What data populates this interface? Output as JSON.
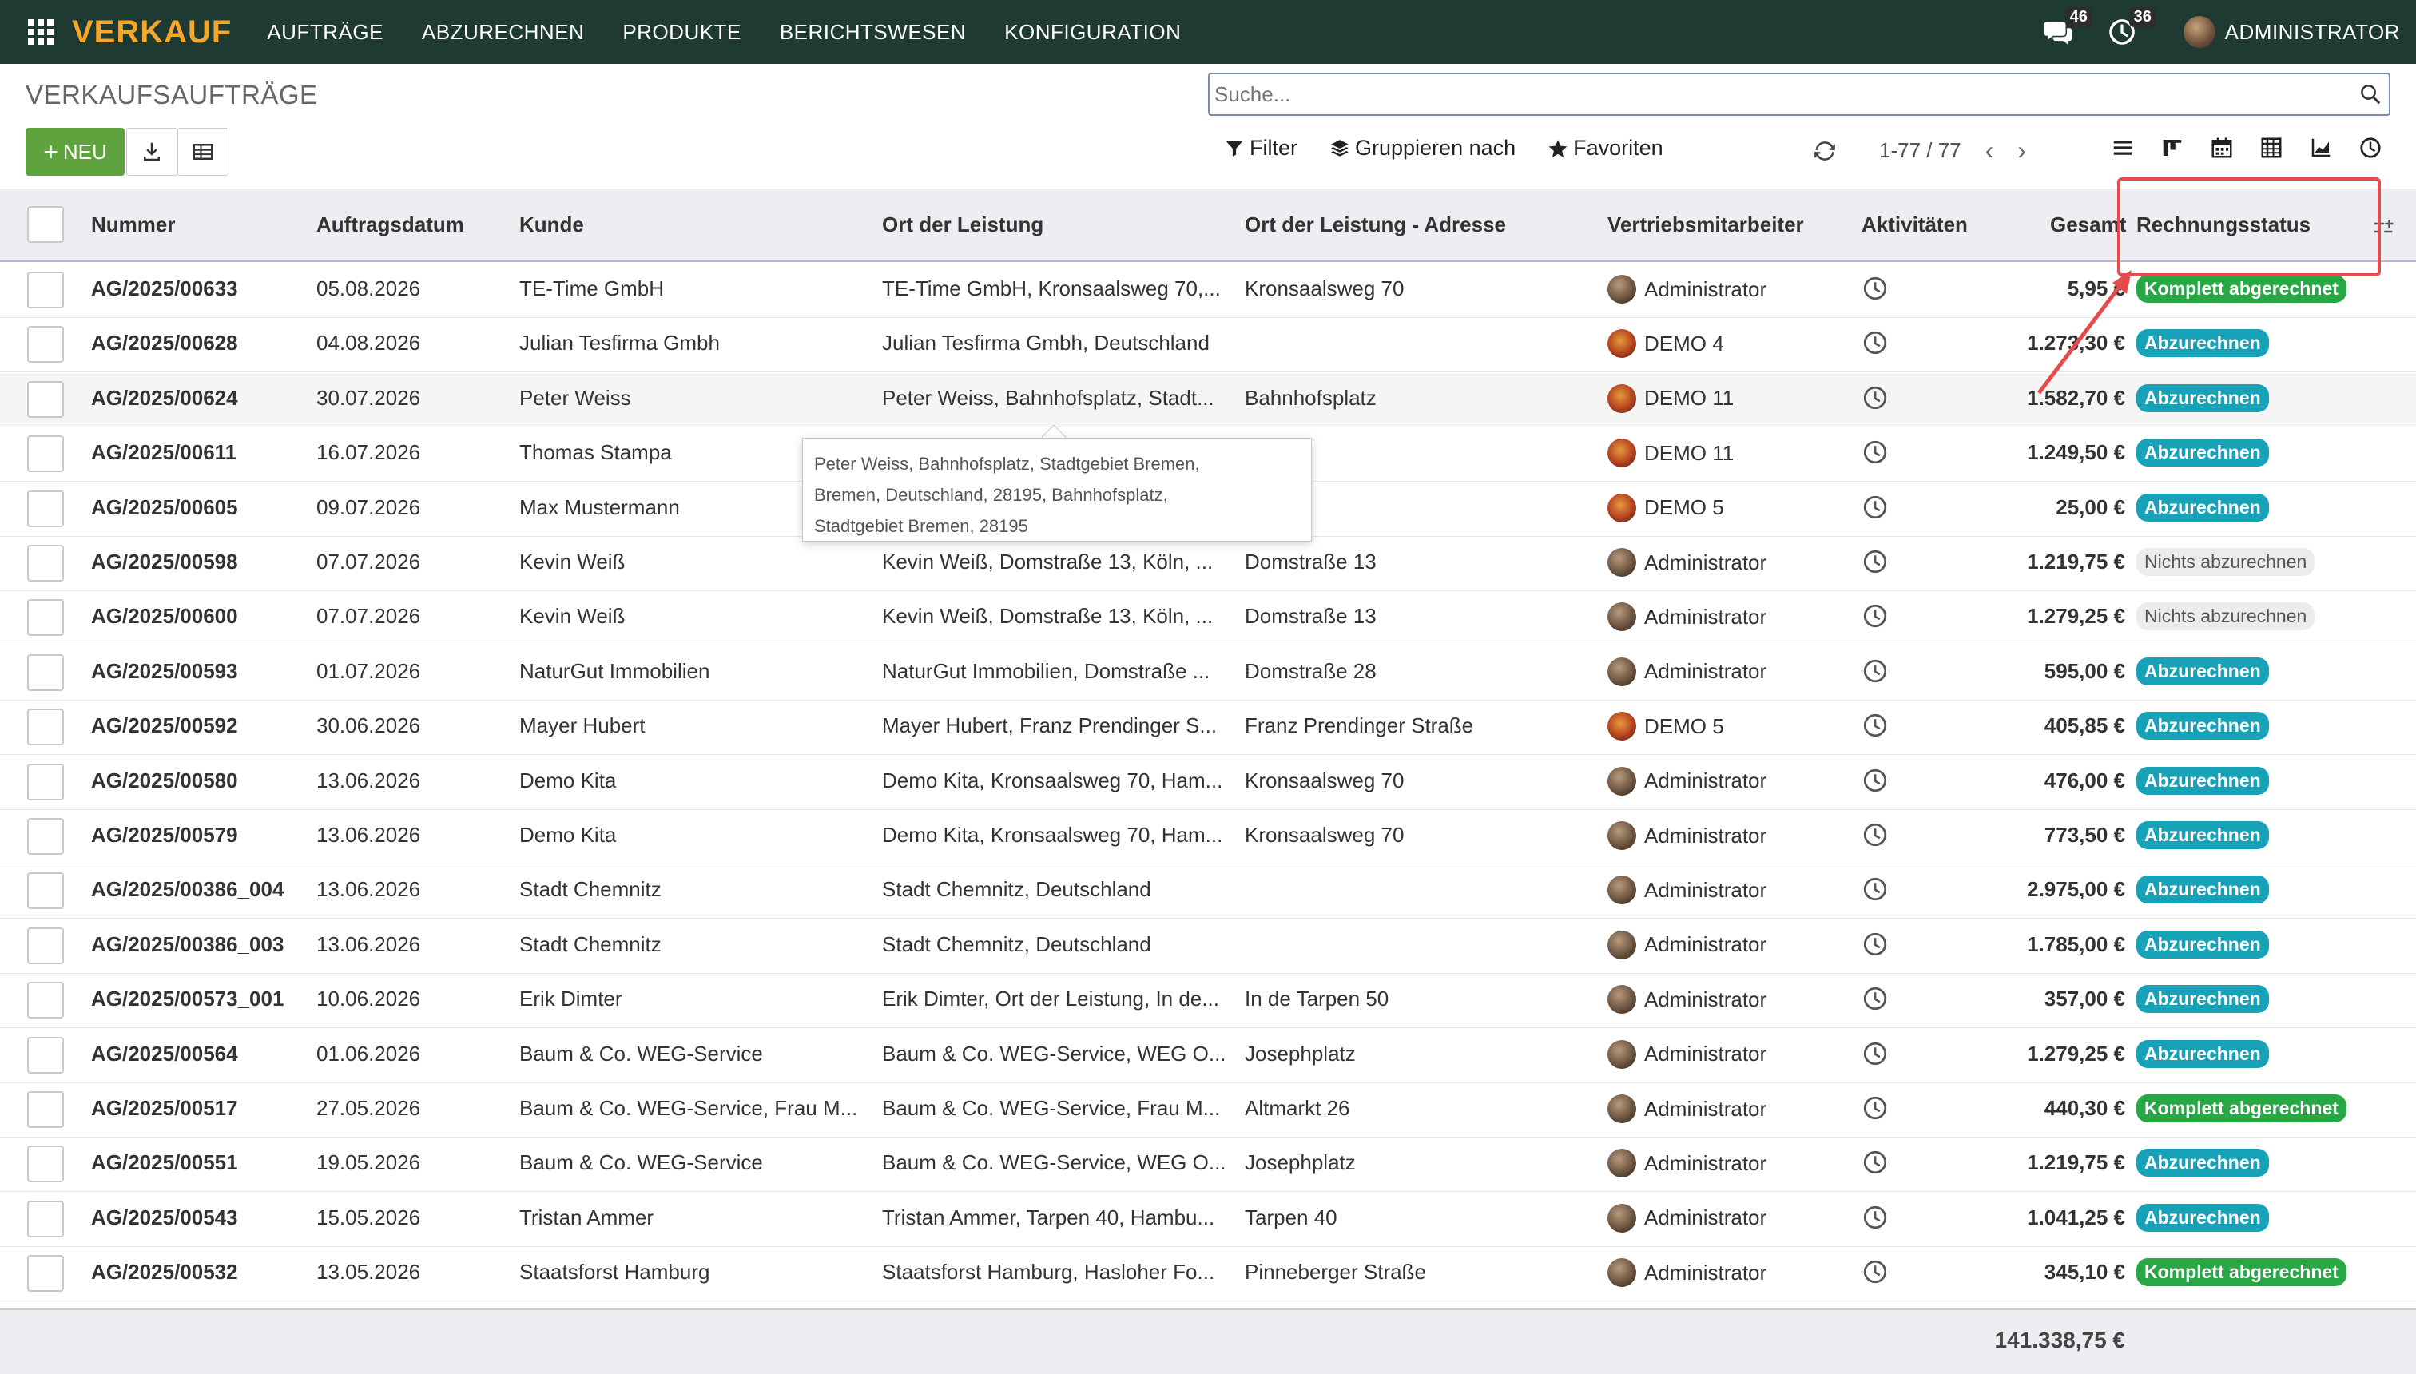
{
  "topbar": {
    "brand": "VERKAUF",
    "menu": [
      "AUFTRÄGE",
      "ABZURECHNEN",
      "PRODUKTE",
      "BERICHTSWESEN",
      "KONFIGURATION"
    ],
    "messages_count": "46",
    "activities_count": "36",
    "user": "ADMINISTRATOR"
  },
  "control": {
    "title": "VERKAUFSAUFTRÄGE",
    "search_placeholder": "Suche...",
    "new_label": "NEU",
    "filter_label": "Filter",
    "group_label": "Gruppieren nach",
    "favorites_label": "Favoriten",
    "pager": "1-77 / 77"
  },
  "table": {
    "headers": {
      "number": "Nummer",
      "date": "Auftragsdatum",
      "customer": "Kunde",
      "location": "Ort der Leistung",
      "address": "Ort der Leistung - Adresse",
      "salesperson": "Vertriebsmitarbeiter",
      "activities": "Aktivitäten",
      "total": "Gesamt",
      "status": "Rechnungsstatus"
    },
    "rows": [
      {
        "number": "AG/2025/00633",
        "date": "05.08.2026",
        "customer": "TE-Time GmbH",
        "location": "TE-Time GmbH, Kronsaalsweg 70,...",
        "address": "Kronsaalsweg 70",
        "salesperson": "Administrator",
        "total": "5,95 €",
        "status": "Komplett abgerechnet",
        "status_type": "green"
      },
      {
        "number": "AG/2025/00628",
        "date": "04.08.2026",
        "customer": "Julian Tesfirma Gmbh",
        "location": "Julian Tesfirma Gmbh, Deutschland",
        "address": "",
        "salesperson": "DEMO 4",
        "total": "1.273,30 €",
        "status": "Abzurechnen",
        "status_type": "cyan"
      },
      {
        "number": "AG/2025/00624",
        "date": "30.07.2026",
        "customer": "Peter Weiss",
        "location": "Peter Weiss, Bahnhofsplatz, Stadt...",
        "address": "Bahnhofsplatz",
        "salesperson": "DEMO 11",
        "total": "1.582,70 €",
        "status": "Abzurechnen",
        "status_type": "cyan"
      },
      {
        "number": "AG/2025/00611",
        "date": "16.07.2026",
        "customer": "Thomas Stampa",
        "location": "",
        "address": "ainau 1",
        "salesperson": "DEMO 11",
        "total": "1.249,50 €",
        "status": "Abzurechnen",
        "status_type": "cyan"
      },
      {
        "number": "AG/2025/00605",
        "date": "09.07.2026",
        "customer": "Max Mustermann",
        "location": "",
        "address": "",
        "salesperson": "DEMO 5",
        "total": "25,00 €",
        "status": "Abzurechnen",
        "status_type": "cyan"
      },
      {
        "number": "AG/2025/00598",
        "date": "07.07.2026",
        "customer": "Kevin Weiß",
        "location": "Kevin Weiß, Domstraße 13, Köln, ...",
        "address": "Domstraße 13",
        "salesperson": "Administrator",
        "total": "1.219,75 €",
        "status": "Nichts abzurechnen",
        "status_type": "grey"
      },
      {
        "number": "AG/2025/00600",
        "date": "07.07.2026",
        "customer": "Kevin Weiß",
        "location": "Kevin Weiß, Domstraße 13, Köln, ...",
        "address": "Domstraße 13",
        "salesperson": "Administrator",
        "total": "1.279,25 €",
        "status": "Nichts abzurechnen",
        "status_type": "grey"
      },
      {
        "number": "AG/2025/00593",
        "date": "01.07.2026",
        "customer": "NaturGut Immobilien",
        "location": "NaturGut Immobilien, Domstraße ...",
        "address": "Domstraße 28",
        "salesperson": "Administrator",
        "total": "595,00 €",
        "status": "Abzurechnen",
        "status_type": "cyan"
      },
      {
        "number": "AG/2025/00592",
        "date": "30.06.2026",
        "customer": "Mayer Hubert",
        "location": "Mayer Hubert, Franz Prendinger S...",
        "address": "Franz Prendinger Straße",
        "salesperson": "DEMO 5",
        "total": "405,85 €",
        "status": "Abzurechnen",
        "status_type": "cyan"
      },
      {
        "number": "AG/2025/00580",
        "date": "13.06.2026",
        "customer": "Demo Kita",
        "location": "Demo Kita, Kronsaalsweg 70, Ham...",
        "address": "Kronsaalsweg 70",
        "salesperson": "Administrator",
        "total": "476,00 €",
        "status": "Abzurechnen",
        "status_type": "cyan"
      },
      {
        "number": "AG/2025/00579",
        "date": "13.06.2026",
        "customer": "Demo Kita",
        "location": "Demo Kita, Kronsaalsweg 70, Ham...",
        "address": "Kronsaalsweg 70",
        "salesperson": "Administrator",
        "total": "773,50 €",
        "status": "Abzurechnen",
        "status_type": "cyan"
      },
      {
        "number": "AG/2025/00386_004",
        "date": "13.06.2026",
        "customer": "Stadt Chemnitz",
        "location": "Stadt Chemnitz, Deutschland",
        "address": "",
        "salesperson": "Administrator",
        "total": "2.975,00 €",
        "status": "Abzurechnen",
        "status_type": "cyan"
      },
      {
        "number": "AG/2025/00386_003",
        "date": "13.06.2026",
        "customer": "Stadt Chemnitz",
        "location": "Stadt Chemnitz, Deutschland",
        "address": "",
        "salesperson": "Administrator",
        "total": "1.785,00 €",
        "status": "Abzurechnen",
        "status_type": "cyan"
      },
      {
        "number": "AG/2025/00573_001",
        "date": "10.06.2026",
        "customer": "Erik Dimter",
        "location": "Erik Dimter, Ort der Leistung, In de...",
        "address": "In de Tarpen 50",
        "salesperson": "Administrator",
        "total": "357,00 €",
        "status": "Abzurechnen",
        "status_type": "cyan"
      },
      {
        "number": "AG/2025/00564",
        "date": "01.06.2026",
        "customer": "Baum & Co. WEG-Service",
        "location": "Baum & Co. WEG-Service, WEG O...",
        "address": "Josephplatz",
        "salesperson": "Administrator",
        "total": "1.279,25 €",
        "status": "Abzurechnen",
        "status_type": "cyan"
      },
      {
        "number": "AG/2025/00517",
        "date": "27.05.2026",
        "customer": "Baum & Co. WEG-Service, Frau M...",
        "location": "Baum & Co. WEG-Service, Frau M...",
        "address": "Altmarkt 26",
        "salesperson": "Administrator",
        "total": "440,30 €",
        "status": "Komplett abgerechnet",
        "status_type": "green"
      },
      {
        "number": "AG/2025/00551",
        "date": "19.05.2026",
        "customer": "Baum & Co. WEG-Service",
        "location": "Baum & Co. WEG-Service, WEG O...",
        "address": "Josephplatz",
        "salesperson": "Administrator",
        "total": "1.219,75 €",
        "status": "Abzurechnen",
        "status_type": "cyan"
      },
      {
        "number": "AG/2025/00543",
        "date": "15.05.2026",
        "customer": "Tristan Ammer",
        "location": "Tristan Ammer, Tarpen 40, Hambu...",
        "address": "Tarpen 40",
        "salesperson": "Administrator",
        "total": "1.041,25 €",
        "status": "Abzurechnen",
        "status_type": "cyan"
      },
      {
        "number": "AG/2025/00532",
        "date": "13.05.2026",
        "customer": "Staatsforst Hamburg",
        "location": "Staatsforst Hamburg, Hasloher Fo...",
        "address": "Pinneberger Straße",
        "salesperson": "Administrator",
        "total": "345,10 €",
        "status": "Komplett abgerechnet",
        "status_type": "green"
      }
    ],
    "footer_total": "141.338,75 €"
  },
  "tooltip": {
    "lines": [
      "Peter Weiss, Bahnhofsplatz, Stadtgebiet Bremen,",
      "Bremen, Deutschland, 28195, Bahnhofsplatz,",
      "Stadtgebiet Bremen, 28195"
    ]
  }
}
